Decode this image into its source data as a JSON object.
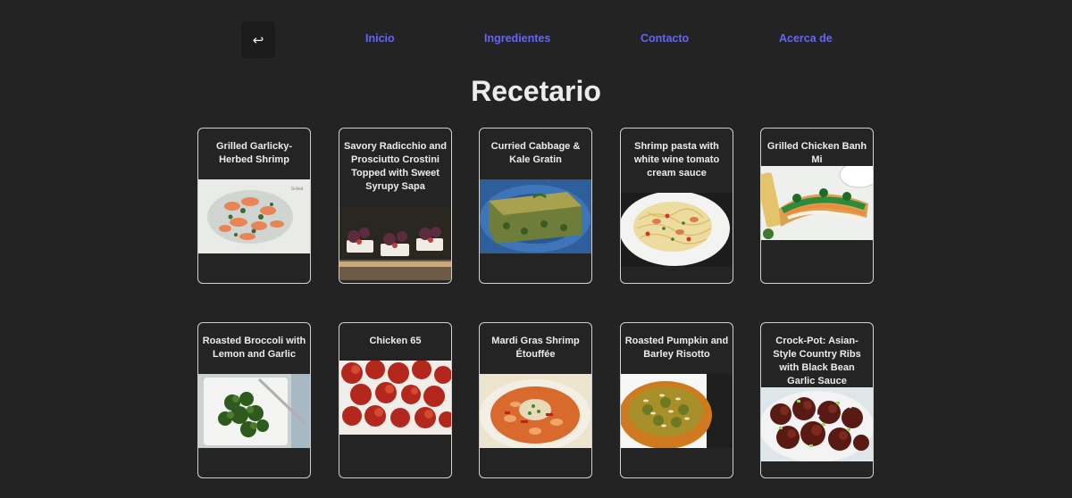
{
  "nav": {
    "back_icon": "return-arrow-icon",
    "back_glyph": "↩",
    "links": [
      "Inicio",
      "Ingredientes",
      "Contacto",
      "Acerca de"
    ]
  },
  "page": {
    "title": "Recetario"
  },
  "recipes": [
    {
      "title": "Grilled Garlicky-Herbed Shrimp"
    },
    {
      "title": "Savory Radicchio and Prosciutto Crostini Topped with Sweet Syrupy Sapa"
    },
    {
      "title": "Curried Cabbage & Kale Gratin"
    },
    {
      "title": "Shrimp pasta with white wine tomato cream sauce"
    },
    {
      "title": "Grilled Chicken Banh Mi"
    },
    {
      "title": "Roasted Broccoli with Lemon and Garlic"
    },
    {
      "title": "Chicken 65"
    },
    {
      "title": "Mardi Gras Shrimp Étouffée"
    },
    {
      "title": "Roasted Pumpkin and Barley Risotto"
    },
    {
      "title": "Crock-Pot: Asian-Style Country Ribs with Black Bean Garlic Sauce"
    }
  ],
  "colors": {
    "background": "#232323",
    "link": "#6466f0",
    "card_border": "#d0d0d0"
  }
}
